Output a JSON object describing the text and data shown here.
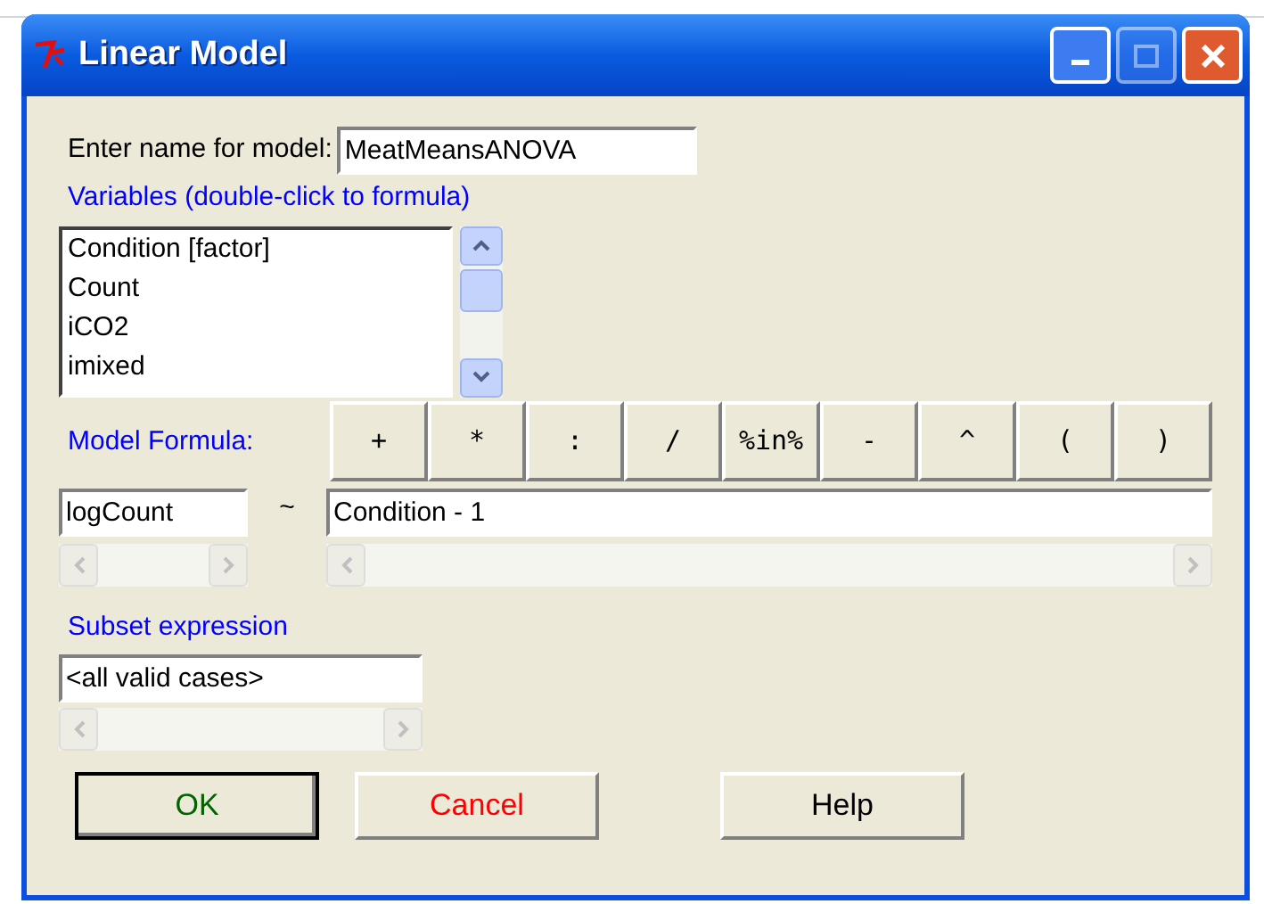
{
  "window": {
    "title": "Linear Model",
    "controls": [
      {
        "kind": "minimize",
        "disabled": false
      },
      {
        "kind": "maximize",
        "disabled": true
      },
      {
        "kind": "close",
        "disabled": false
      }
    ]
  },
  "model_name": {
    "label": "Enter name for model:",
    "value": "MeatMeansANOVA"
  },
  "variables": {
    "label": "Variables (double-click to formula)",
    "items": [
      "Condition [factor]",
      "Count",
      "iCO2",
      "imixed"
    ]
  },
  "formula": {
    "label": "Model Formula:",
    "operators": [
      "+",
      "*",
      ":",
      "/",
      "%in%",
      "-",
      "^",
      "(",
      ")"
    ],
    "response": "logCount",
    "tilde": "~",
    "rhs": "Condition - 1"
  },
  "subset": {
    "label": "Subset expression",
    "value": "<all valid cases>"
  },
  "buttons": [
    {
      "label": "OK",
      "color": "#006400",
      "default": true
    },
    {
      "label": "Cancel",
      "color": "#ff0000",
      "default": false
    },
    {
      "label": "Help",
      "color": "#000000",
      "default": false
    }
  ]
}
